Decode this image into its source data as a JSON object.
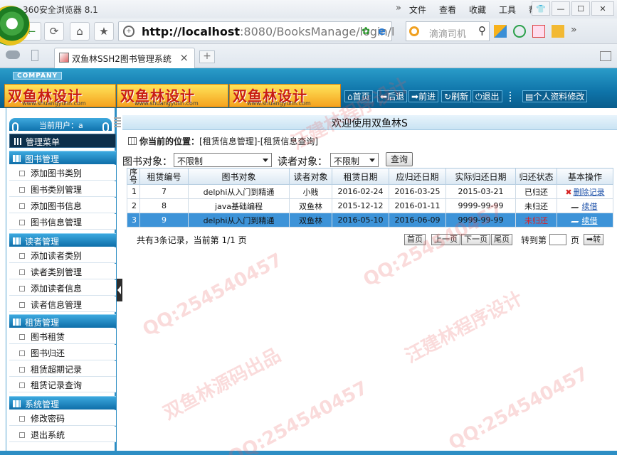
{
  "browser": {
    "app_title": "360安全浏览器 8.1",
    "menu_double_arrow": "»",
    "menus": [
      "文件",
      "查看",
      "收藏",
      "工具",
      "帮助"
    ],
    "url_host": "http://localhost",
    "url_path": ":8080/BooksManage/login/l",
    "search_placeholder": "滴滴司机",
    "tab_title": "双鱼林SSH2图书管理系统",
    "tab_close": "×",
    "new_tab": "+"
  },
  "header": {
    "company": "COMPANY",
    "banner_text": "双鱼林设计",
    "banner_url": "www.shuangyulin.com",
    "nav": [
      "首页",
      "后退",
      "前进",
      "刷新",
      "退出"
    ],
    "profile": "个人资料修改"
  },
  "sidebar": {
    "current_user_label": "当前用户：a",
    "manage_menu": "管理菜单",
    "sections": [
      {
        "title": "图书管理",
        "items": [
          "添加图书类别",
          "图书类别管理",
          "添加图书信息",
          "图书信息管理"
        ]
      },
      {
        "title": "读者管理",
        "items": [
          "添加读者类别",
          "读者类别管理",
          "添加读者信息",
          "读者信息管理"
        ]
      },
      {
        "title": "租赁管理",
        "items": [
          "图书租赁",
          "图书归还",
          "租赁超期记录",
          "租赁记录查询"
        ]
      },
      {
        "title": "系统管理",
        "items": [
          "修改密码",
          "退出系统"
        ]
      }
    ]
  },
  "main": {
    "welcome": "欢迎使用双鱼林S",
    "location_label": "你当前的位置：",
    "location_path": "[租赁信息管理]-[租赁信息查询]",
    "filter": {
      "book_label": "图书对象：",
      "book_value": "不限制",
      "reader_label": "读者对象：",
      "reader_value": "不限制",
      "query_button": "查询"
    },
    "table": {
      "headers": [
        "序号",
        "租赁编号",
        "图书对象",
        "读者对象",
        "租赁日期",
        "应归还日期",
        "实际归还日期",
        "归还状态",
        "基本操作"
      ],
      "rows": [
        {
          "no": "1",
          "id": "7",
          "book": "delphi从入门到精通",
          "reader": "小贱",
          "rent": "2016-02-24",
          "due": "2016-03-25",
          "returned": "2015-03-21",
          "status": "已归还",
          "action": "删除记录"
        },
        {
          "no": "2",
          "id": "8",
          "book": "java基础编程",
          "reader": "双鱼林",
          "rent": "2015-12-12",
          "due": "2016-01-11",
          "returned": "9999-99-99",
          "status": "未归还",
          "action": "续借"
        },
        {
          "no": "3",
          "id": "9",
          "book": "delphi从入门到精通",
          "reader": "双鱼林",
          "rent": "2016-05-10",
          "due": "2016-06-09",
          "returned": "9999-99-99",
          "status": "未归还",
          "action": "续借"
        }
      ]
    },
    "pager": {
      "info": "共有3条记录，当前第 1/1 页",
      "first": "首页",
      "prev": "上一页",
      "next": "下一页",
      "last": "尾页",
      "goto_label": "转到第",
      "page_suffix": "页",
      "go_button": "➡转"
    }
  },
  "watermarks": {
    "qq": "QQ:254540457",
    "source": "双鱼林源码出品",
    "author": "汪建林程序设计"
  }
}
